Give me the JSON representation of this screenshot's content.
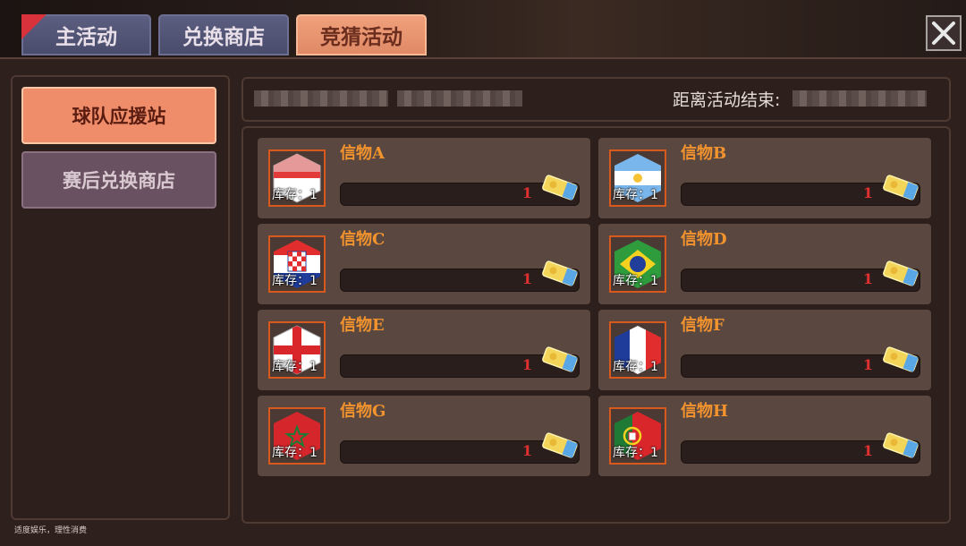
{
  "tabs": [
    {
      "label": "主活动",
      "active": false
    },
    {
      "label": "兑换商店",
      "active": false
    },
    {
      "label": "竞猜活动",
      "active": true
    }
  ],
  "sidebar": {
    "items": [
      {
        "label": "球队应援站",
        "active": true
      },
      {
        "label": "赛后兑换商店",
        "active": false
      }
    ]
  },
  "info_bar": {
    "end_label": "距离活动结束:"
  },
  "cards": [
    {
      "name": "信物A",
      "stock": "库存：1",
      "value": "1",
      "icon": "shield-red-white-icon"
    },
    {
      "name": "信物B",
      "stock": "库存：1",
      "value": "1",
      "icon": "shield-argentina-icon"
    },
    {
      "name": "信物C",
      "stock": "库存：1",
      "value": "1",
      "icon": "shield-croatia-icon"
    },
    {
      "name": "信物D",
      "stock": "库存：1",
      "value": "1",
      "icon": "shield-brazil-icon"
    },
    {
      "name": "信物E",
      "stock": "库存：1",
      "value": "1",
      "icon": "shield-england-icon"
    },
    {
      "name": "信物F",
      "stock": "库存：1",
      "value": "1",
      "icon": "shield-france-icon"
    },
    {
      "name": "信物G",
      "stock": "库存：1",
      "value": "1",
      "icon": "shield-morocco-icon"
    },
    {
      "name": "信物H",
      "stock": "库存：1",
      "value": "1",
      "icon": "shield-portugal-icon"
    }
  ],
  "footer": {
    "note": "适度娱乐，理性消费"
  },
  "colors": {
    "accent_orange": "#f2932e",
    "active_tab": "#e08a66",
    "value_red": "#e03030"
  }
}
